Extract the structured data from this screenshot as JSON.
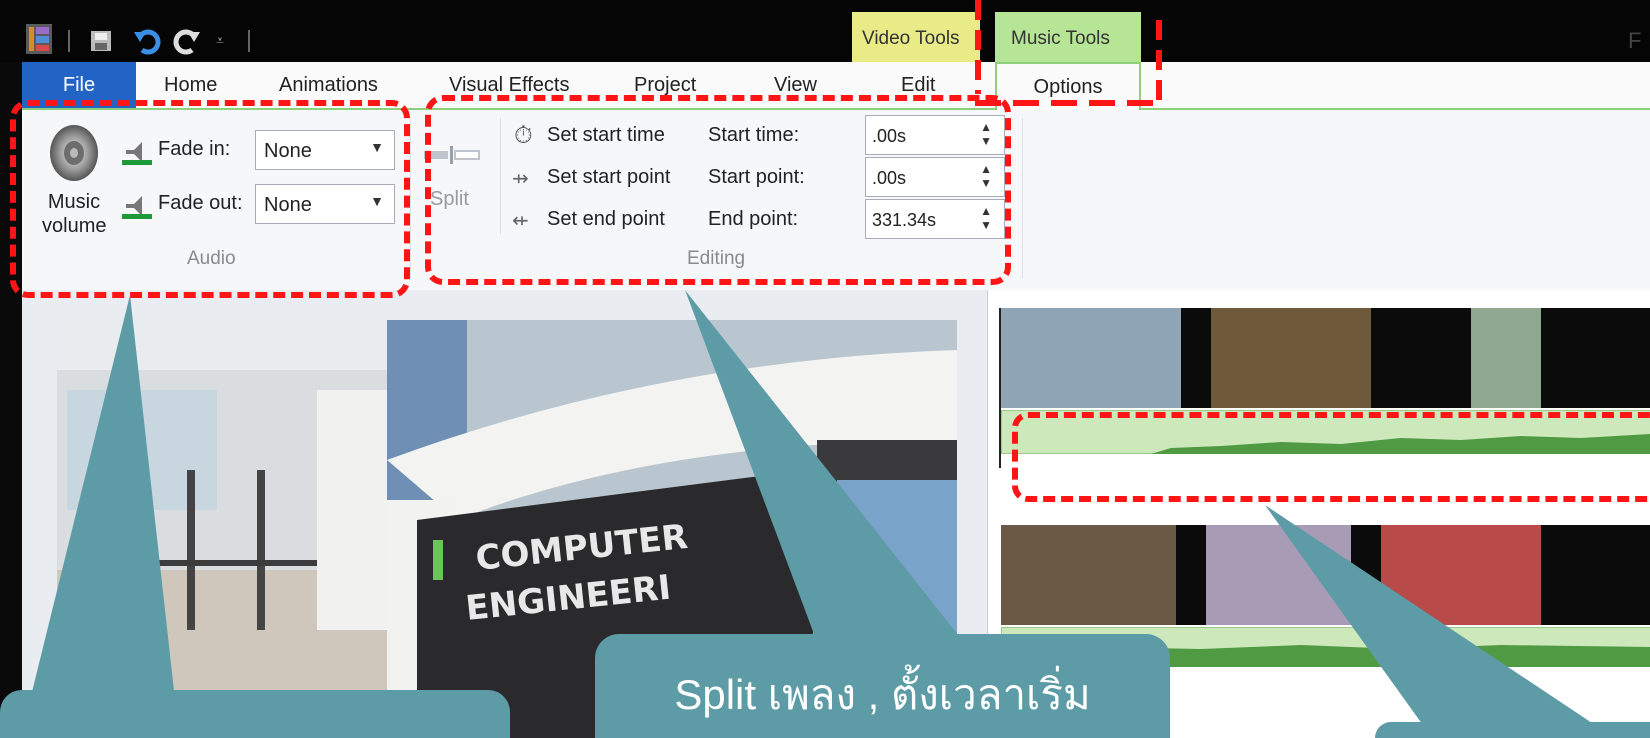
{
  "contextual_tabs": {
    "video_tools": "Video Tools",
    "music_tools": "Music Tools",
    "window_title_fragment": "F"
  },
  "tabs": [
    "File",
    "Home",
    "Animations",
    "Visual Effects",
    "Project",
    "View",
    "Edit",
    "Options"
  ],
  "ribbon": {
    "audio": {
      "music_volume_line1": "Music",
      "music_volume_line2": "volume",
      "fade_in_label": "Fade in:",
      "fade_in_value": "None",
      "fade_out_label": "Fade out:",
      "fade_out_value": "None",
      "group_label": "Audio"
    },
    "editing": {
      "split_label": "Split",
      "set_start_time": "Set start time",
      "set_start_point": "Set start point",
      "set_end_point": "Set end point",
      "start_time_label": "Start time:",
      "start_time_value": ".00s",
      "start_point_label": "Start point:",
      "start_point_value": ".00s",
      "end_point_label": "End point:",
      "end_point_value": "331.34s",
      "group_label": "Editing"
    }
  },
  "preview": {
    "sign_text_line1": "COMPUTER",
    "sign_text_line2": "ENGINEERI"
  },
  "annotations": {
    "callout_middle": "Split เพลง , ตั้งเวลาเริ่ม"
  },
  "colors": {
    "accent_file_tab": "#2264c6",
    "video_tools": "#e9ec86",
    "music_tools": "#b7e596",
    "annotation_dash": "#ff1515",
    "callout": "#5d9ca6"
  }
}
